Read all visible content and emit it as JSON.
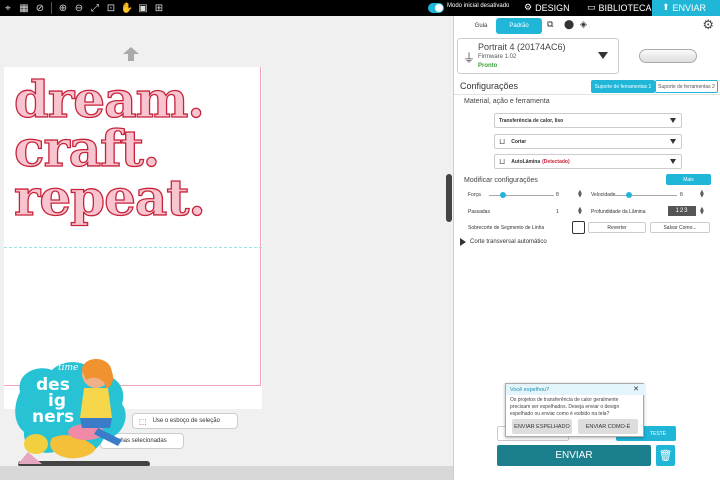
{
  "topbar": {
    "tool_icons": [
      "⌖",
      "▦",
      "⊘",
      "⊕",
      "⊖",
      "⤢",
      "⊡",
      "✋",
      "▣",
      "⊞"
    ],
    "initial_mode_label": "Modo inicial desativado",
    "tabs": [
      {
        "label": "DESIGN",
        "icon": "⚙"
      },
      {
        "label": "BIBLIOTECA",
        "icon": "▭"
      },
      {
        "label": "ENVIAR",
        "icon": "⬆"
      }
    ]
  },
  "canvas": {
    "words": [
      "dream.",
      "craft.",
      "repeat."
    ],
    "text_fill": "#f8c4cf",
    "text_stroke": "#c7243b",
    "sketch_label": "Use o esboço de seleção",
    "selected_label": "nhas selecionadas"
  },
  "mascot": {
    "line1": "time",
    "line2": "des",
    "line3": "ig",
    "line4": "ners"
  },
  "panel": {
    "segments": {
      "guide": "Guia",
      "standard": "Padrão"
    },
    "device": {
      "name": "Portrait 4 (20174AC6)",
      "firmware": "Firmware 1.02",
      "status": "Pronto"
    },
    "config_title": "Configurações",
    "config_tabs": [
      "Suporte de ferramentas 1",
      "Suporte de ferramentas 2"
    ],
    "material_heading": "Material, ação e ferramenta",
    "material": "Transferência de calor, liso",
    "action": "Cortar",
    "tool": "AutoLâmina",
    "tool_status": "(Detectado)",
    "modify_heading": "Modificar configurações",
    "more_label": "Mais",
    "force_label": "Força",
    "force_value": "8",
    "speed_label": "Velocidade",
    "speed_value": "8",
    "passes_label": "Passadas",
    "passes_value": "1",
    "depth_label": "Profundidade da Lâmina",
    "depth_value": "123",
    "overcut_label": "Sobrecorte de Segmento de Linha",
    "revert_label": "Reverter",
    "save_as_label": "Salvar Como...",
    "cross_cut_label": "Corte transversal automático"
  },
  "popup": {
    "title": "Você espelhou?",
    "close": "✕",
    "text": "Os projetos de transferência de calor geralmente precisam ser espelhados. Deseja enviar o design espelhado ou enviar como é exibido na tela?",
    "mirrored_button": "ENVIAR ESPELHADO",
    "as_is_button": "ENVIAR COMO-É"
  },
  "behind_test": "TESTE",
  "send_button": "ENVIAR",
  "trash_icon": "🗑"
}
